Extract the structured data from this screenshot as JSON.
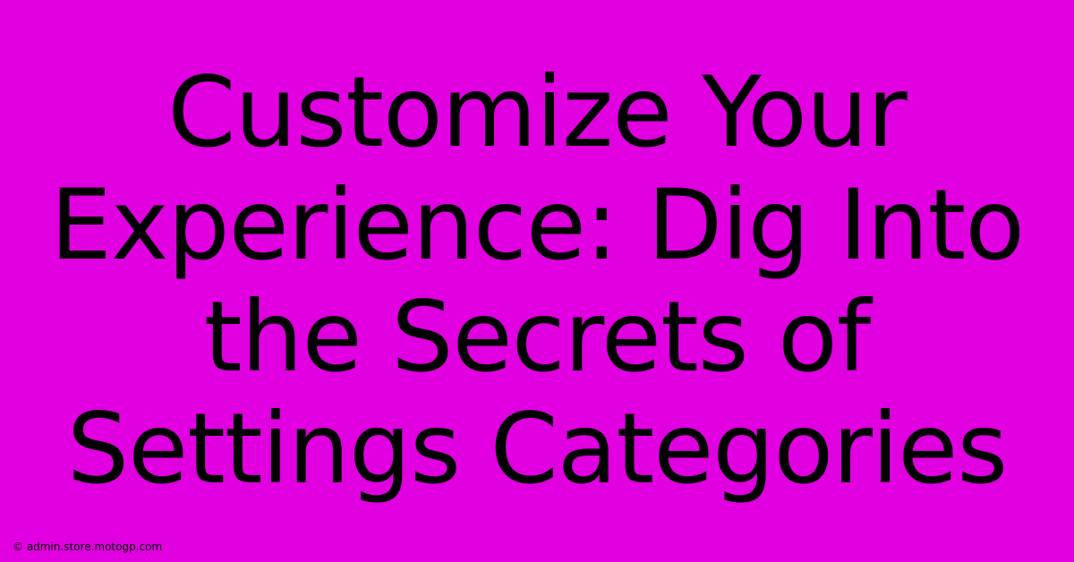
{
  "headline": "Customize Your Experience: Dig Into the Secrets of Settings Categories",
  "footer": "© admin.store.motogp.com"
}
